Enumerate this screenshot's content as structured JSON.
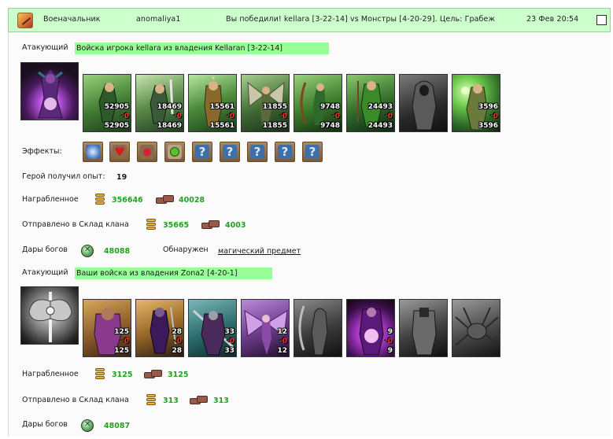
{
  "header": {
    "role": "Военачальник",
    "username": "anomaliya1",
    "battle_summary": "Вы победили! kellara [3-22-14] vs Монстры [4-20-29]. Цель: Грабеж",
    "datetime": "23 Фев 20:54"
  },
  "attacker_section": {
    "label": "Атакующий",
    "banner": "Войска игрока kellara из владения Kellaran [3-22-14]",
    "units": [
      {
        "name": "elf-warrior",
        "count": "52905",
        "loss": "-0",
        "remaining": "52905"
      },
      {
        "name": "swordsman",
        "count": "18469",
        "loss": "-0",
        "remaining": "18469"
      },
      {
        "name": "guard",
        "count": "15561",
        "loss": "-0",
        "remaining": "15561"
      },
      {
        "name": "winged-warrior",
        "count": "11855",
        "loss": "-0",
        "remaining": "11855"
      },
      {
        "name": "archer",
        "count": "9748",
        "loss": "-0",
        "remaining": "9748"
      },
      {
        "name": "druid",
        "count": "24493",
        "loss": "-0",
        "remaining": "24493"
      },
      {
        "name": "dark-unit",
        "count": "",
        "loss": "",
        "remaining": ""
      },
      {
        "name": "mage",
        "count": "3596",
        "loss": "-0",
        "remaining": "3596"
      }
    ],
    "effects_label": "Эффекты:",
    "effects": [
      "shield-icon",
      "heart-icon",
      "cherries-icon",
      "potion-icon",
      "unknown-icon",
      "unknown-icon",
      "unknown-icon",
      "unknown-icon",
      "unknown-icon"
    ],
    "unknown_glyph": "?",
    "hero_exp_label": "Герой получил опыт:",
    "hero_exp_value": "19",
    "looted_label": "Награбленное",
    "looted_gold": "356646",
    "looted_ore": "40028",
    "clan_label": "Отправлено в Склад клана",
    "clan_gold": "35665",
    "clan_ore": "4003",
    "gifts_label": "Дары богов",
    "gifts_value": "48088",
    "found_label": "Обнаружен",
    "found_item": "магический предмет"
  },
  "defender_section": {
    "label": "Атакующий",
    "banner": "Ваши войска из владения Zona2 [4-20-1]",
    "units": [
      {
        "name": "brute",
        "count": "125",
        "loss": "-0",
        "remaining": "125"
      },
      {
        "name": "dark-elf",
        "count": "28",
        "loss": "-0",
        "remaining": "28"
      },
      {
        "name": "warlord",
        "count": "33",
        "loss": "-0",
        "remaining": "33"
      },
      {
        "name": "harpy",
        "count": "12",
        "loss": "-0",
        "remaining": "12"
      },
      {
        "name": "grey-archer",
        "count": "",
        "loss": "",
        "remaining": ""
      },
      {
        "name": "sorcerer",
        "count": "9",
        "loss": "-0",
        "remaining": "9"
      },
      {
        "name": "grey-knight",
        "count": "",
        "loss": "",
        "remaining": ""
      },
      {
        "name": "grey-spider",
        "count": "",
        "loss": "",
        "remaining": ""
      }
    ],
    "looted_label": "Награбленное",
    "looted_gold": "3125",
    "looted_ore": "3125",
    "clan_label": "Отправлено в Склад клана",
    "clan_gold": "313",
    "clan_ore": "313",
    "gifts_label": "Дары богов",
    "gifts_value": "48087"
  },
  "colors": {
    "title_bar": "#ccffcc",
    "banner": "#99ff99",
    "value_green": "#21a121",
    "loss_red": "#ff3030"
  }
}
